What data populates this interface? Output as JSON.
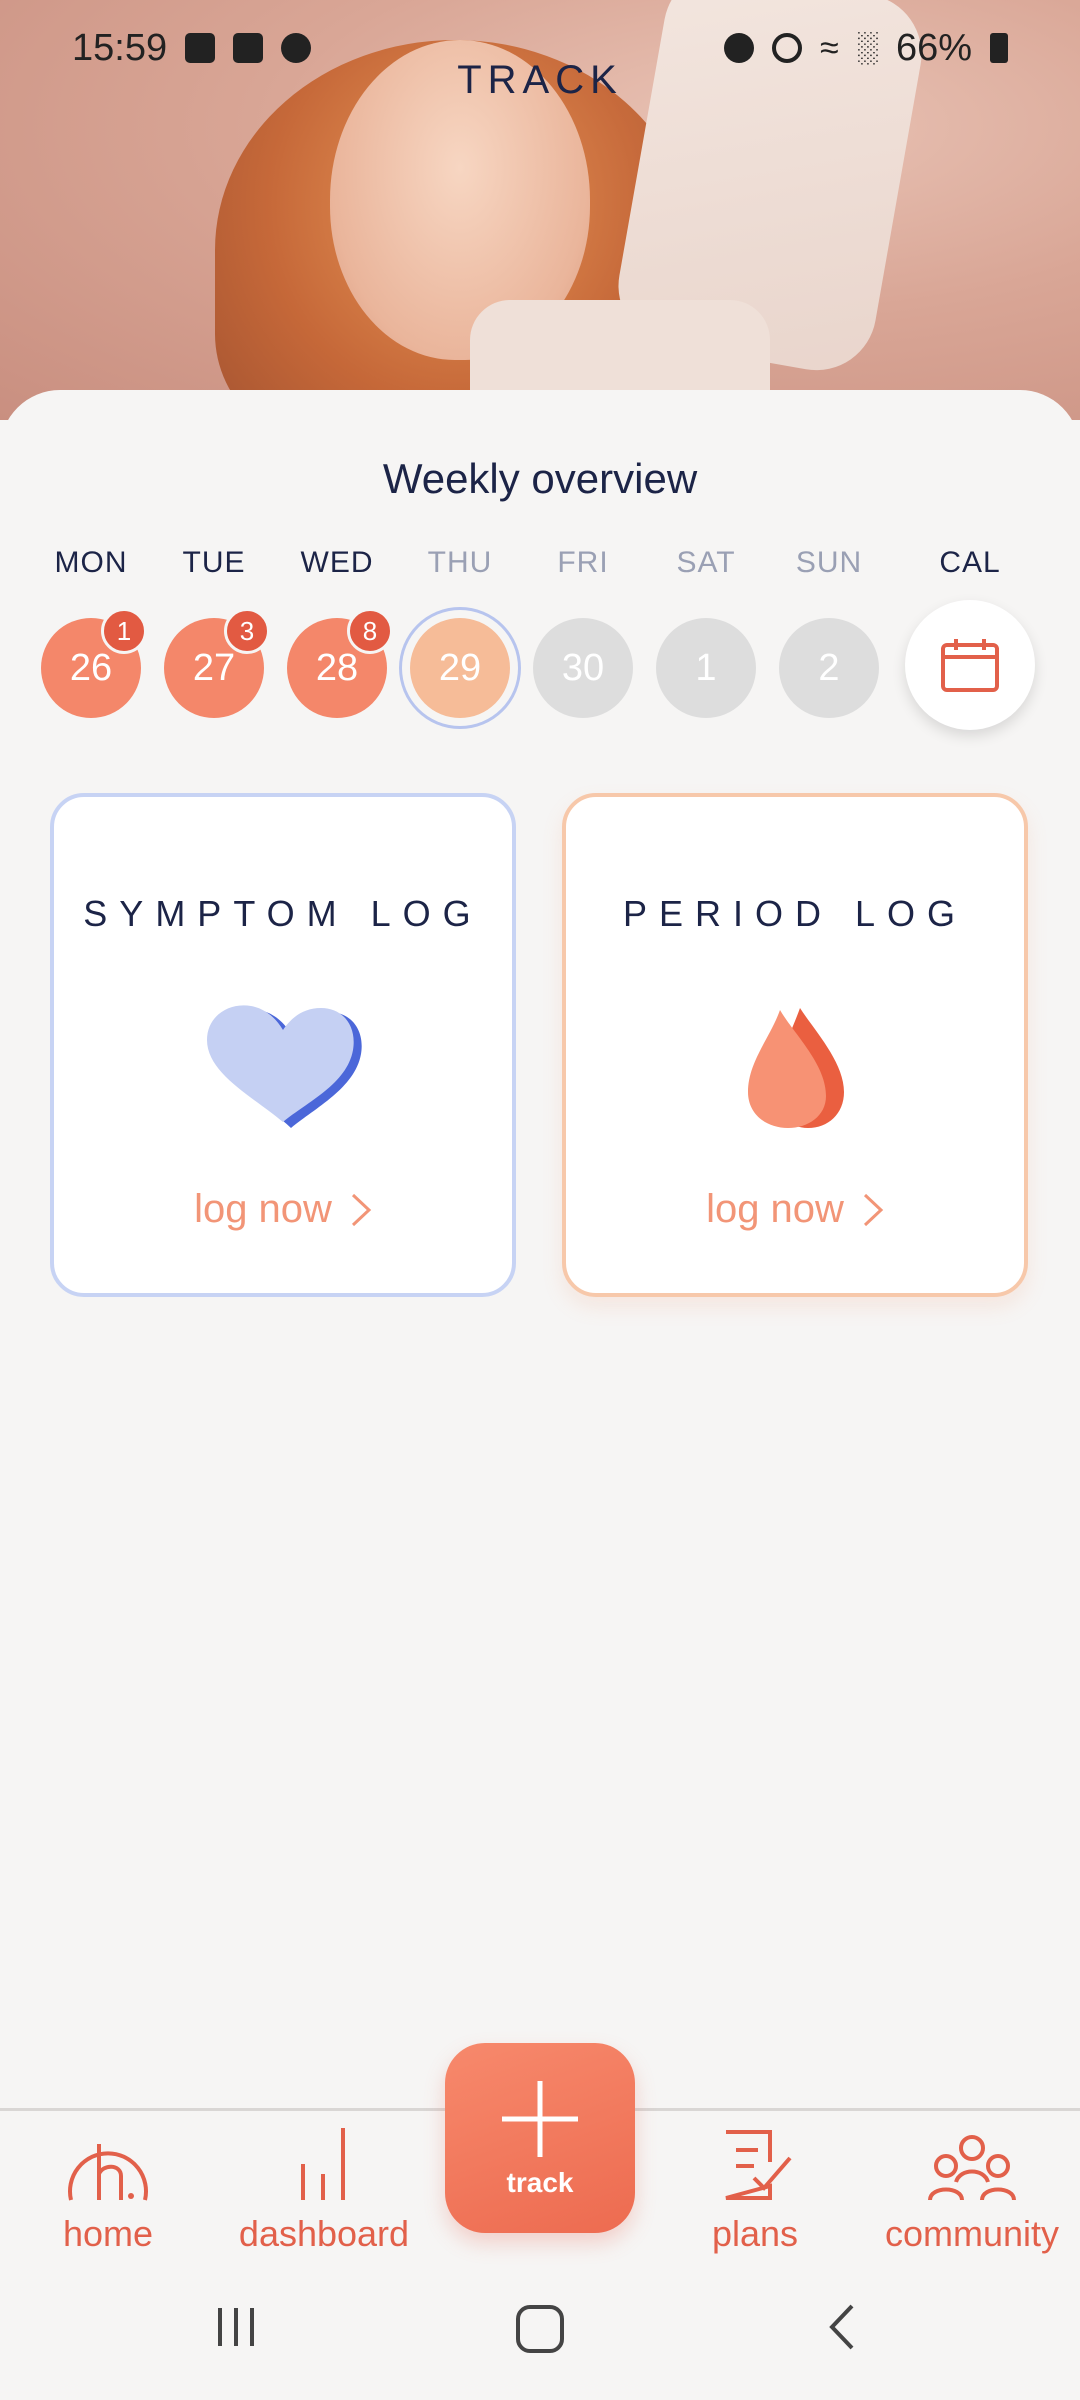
{
  "status_bar": {
    "time": "15:59",
    "battery": "66%",
    "icons_left": [
      "gallery-icon",
      "screen-recorder-icon",
      "message-icon"
    ],
    "icons_right": [
      "alarm-icon",
      "mute-icon",
      "wifi-icon",
      "signal-icon",
      "battery-icon"
    ]
  },
  "header": {
    "title": "TRACK"
  },
  "weekly": {
    "title": "Weekly overview",
    "days": [
      {
        "label": "MON",
        "date": "26",
        "badge": "1",
        "state": "past"
      },
      {
        "label": "TUE",
        "date": "27",
        "badge": "3",
        "state": "past"
      },
      {
        "label": "WED",
        "date": "28",
        "badge": "8",
        "state": "past"
      },
      {
        "label": "THU",
        "date": "29",
        "badge": "",
        "state": "today"
      },
      {
        "label": "FRI",
        "date": "30",
        "badge": "",
        "state": "future"
      },
      {
        "label": "SAT",
        "date": "1",
        "badge": "",
        "state": "future"
      },
      {
        "label": "SUN",
        "date": "2",
        "badge": "",
        "state": "future"
      }
    ],
    "cal_label": "CAL",
    "cal_icon": "calendar-icon"
  },
  "cards": {
    "symptom": {
      "title": "SYMPTOM LOG",
      "link": "log now",
      "icon": "heart-icon",
      "accent": "#c7d3f4"
    },
    "period": {
      "title": "PERIOD LOG",
      "link": "log now",
      "icon": "drop-icon",
      "accent": "#f7c8aa"
    }
  },
  "nav": {
    "items": [
      {
        "label": "home",
        "icon": "home-logo-icon"
      },
      {
        "label": "dashboard",
        "icon": "bar-chart-icon"
      },
      {
        "label": "track",
        "icon": "plus-icon"
      },
      {
        "label": "plans",
        "icon": "clipboard-check-icon"
      },
      {
        "label": "community",
        "icon": "people-icon"
      }
    ]
  },
  "colors": {
    "accent": "#ed6b50",
    "navy": "#1c2447",
    "past_day": "#f4876a",
    "today_day": "#f6bc98"
  }
}
